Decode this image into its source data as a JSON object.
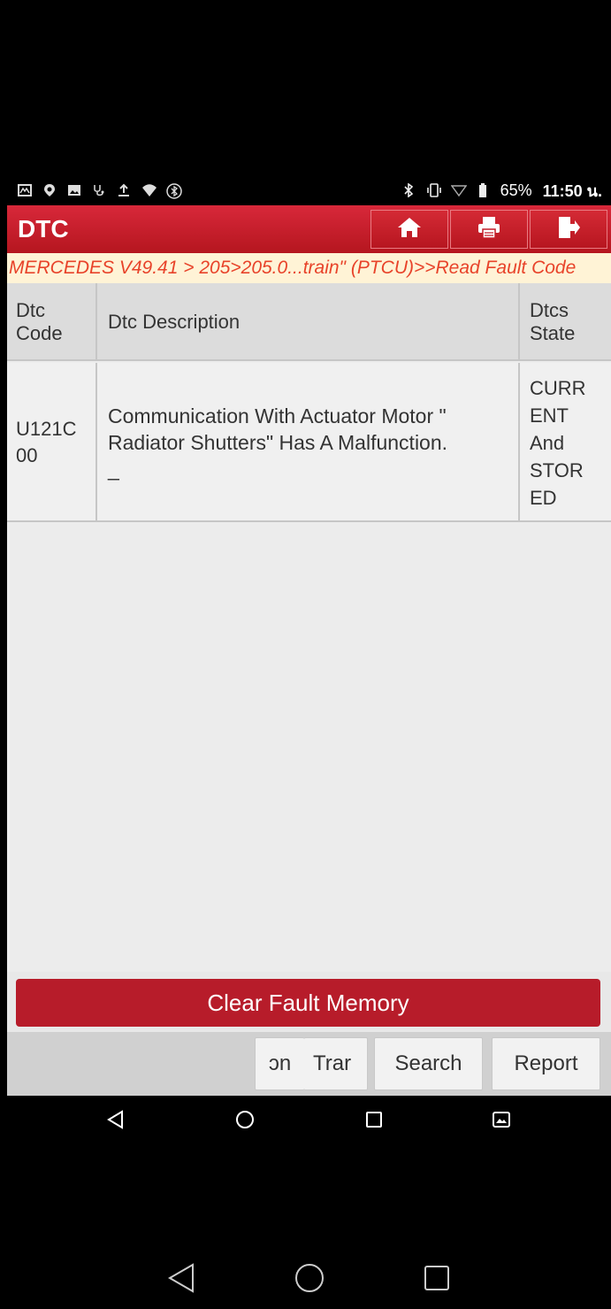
{
  "status_bar": {
    "left_icons": [
      "mail-icon",
      "location-icon",
      "image-icon",
      "stethoscope-icon",
      "upload-icon",
      "wifi-icon",
      "bluetooth-circle-icon"
    ],
    "right_icons": [
      "bluetooth-icon",
      "vibrate-icon",
      "signal-icon",
      "battery-icon"
    ],
    "battery": "65%",
    "time": "11:50 น."
  },
  "header": {
    "title": "DTC",
    "buttons": [
      "home-icon",
      "print-icon",
      "exit-icon"
    ]
  },
  "breadcrumb": "MERCEDES V49.41 > 205>205.0...train\" (PTCU)>>Read Fault Code",
  "table": {
    "columns": [
      {
        "line1": "Dtc",
        "line2": "Code"
      },
      {
        "line1": "Dtc Description",
        "line2": ""
      },
      {
        "line1": "Dtcs",
        "line2": "State"
      }
    ],
    "rows": [
      {
        "code_line1": "U121C",
        "code_line2": "00",
        "desc_line1": "Communication With Actuator Motor \"",
        "desc_line2": "Radiator Shutters\" Has A Malfunction.",
        "desc_line3": "_",
        "state_lines": [
          "CURR",
          "ENT",
          "And",
          "STOR",
          "ED"
        ]
      }
    ]
  },
  "clear_button": "Clear Fault Memory",
  "toolbar": {
    "partial_left": "ɔn",
    "partial_trar": "Trar",
    "search": "Search",
    "report": "Report"
  },
  "colors": {
    "header_red": "#c41f2b",
    "breadcrumb_text": "#e8432a",
    "breadcrumb_bg": "#fff3d6",
    "clear_button": "#b71c2a"
  }
}
